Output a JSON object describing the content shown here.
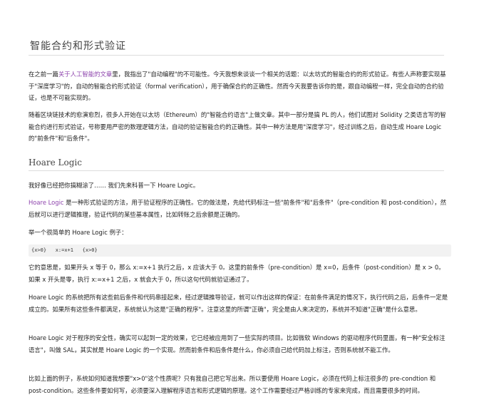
{
  "article": {
    "title": "智能合约和形式验证",
    "intro": {
      "pre": "在之前一篇",
      "link": "关于人工智能的文章",
      "post": "里，我指出了\"自动编程\"的不可能性。今天我想来谈谈一个相关的话题：以太坊式的智能合约的形式验证。有些人声称要实现基于\"深度学习\"的，自动的智能合约形式验证（formal verification），用于确保合约的正确性。然而今天我要告诉你的是，跟自动编程一样，完全自动的合约验证，也是不可能实现的。"
    },
    "p2": "随着区块链技术的愈演愈烈，很多人开始在以太坊（Ethereum）的\"智能合约语言\"上做文章。其中一部分是搞 PL 的人，他们试图对 Solidity 之类语言写的智能合约进行形式验证，号称要用严密的数理逻辑方法，自动的验证智能合约的正确性。其中一种方法是用\"深度学习\"，经过训练之后，自动生成 Hoare Logic 的\"前条件\"和\"后条件\"。",
    "section_heading": "Hoare Logic",
    "p3": "我好像已经把你搞糊涂了…… 我们先来科普一下 Hoare Logic。",
    "p4": {
      "link": "Hoare Logic",
      "post": " 是一种形式验证的方法，用于验证程序的正确性。它的做法是，先给代码标注一些\"前条件\"和\"后条件\"（pre-condition 和 post-condition），然后就可以进行逻辑推理，验证代码的某些基本属性，比如转账之后余额是正确的。"
    },
    "p5": "举一个很简单的 Hoare Logic 例子：",
    "code": "{x>0}   x:=x+1   {x>0}",
    "p6": "它的意思是，如果开头 x 等于 0，那么 x:=x+1 执行之后，x 应该大于 0。这里的前条件（pre-condition）是 x=0，后条件（post-condition）是 x > 0。如果 x 开头是零，执行 x:=x+1 之后，x 就会大于 0，所以这句代码就验证通过了。",
    "p7": "Hoare Logic 的系统把所有这些前后条件和代码串接起来，经过逻辑推导验证，就可以作出这样的保证：在前条件满足的情况下，执行代码之后，后条件一定是成立的。如果所有这些条件都满足，系统就认为这是\"正确的程序\"。注意这里的所谓\"正确\"，完全是由人来决定的，系统并不知道\"正确\"是什么意思。",
    "p8": "Hoare Logic 对于程序的安全性，确实可以起到一定的效果，它已经被应用到了一些实际的项目。比如微软 Windows 的驱动程序代码里面，有一种\"安全标注语言\"，叫做 SAL，其实就是 Hoare Logic 的一个实现。然而前条件和后条件是什么，你必须自己给代码加上标注，否则系统就不能工作。",
    "p9": "比如上面的例子，系统如何知道我想要\"x>0\"这个性质呢？只有我自己把它写出来。所以要使用 Hoare Logic，必须在代码上标注很多的 pre-condtion 和 post-condition。这些条件要如何写，必须要深入理解程序语言和形式逻辑的原理。这个工作需要经过严格训练的专家来完成，而且需要很多的时间。"
  }
}
